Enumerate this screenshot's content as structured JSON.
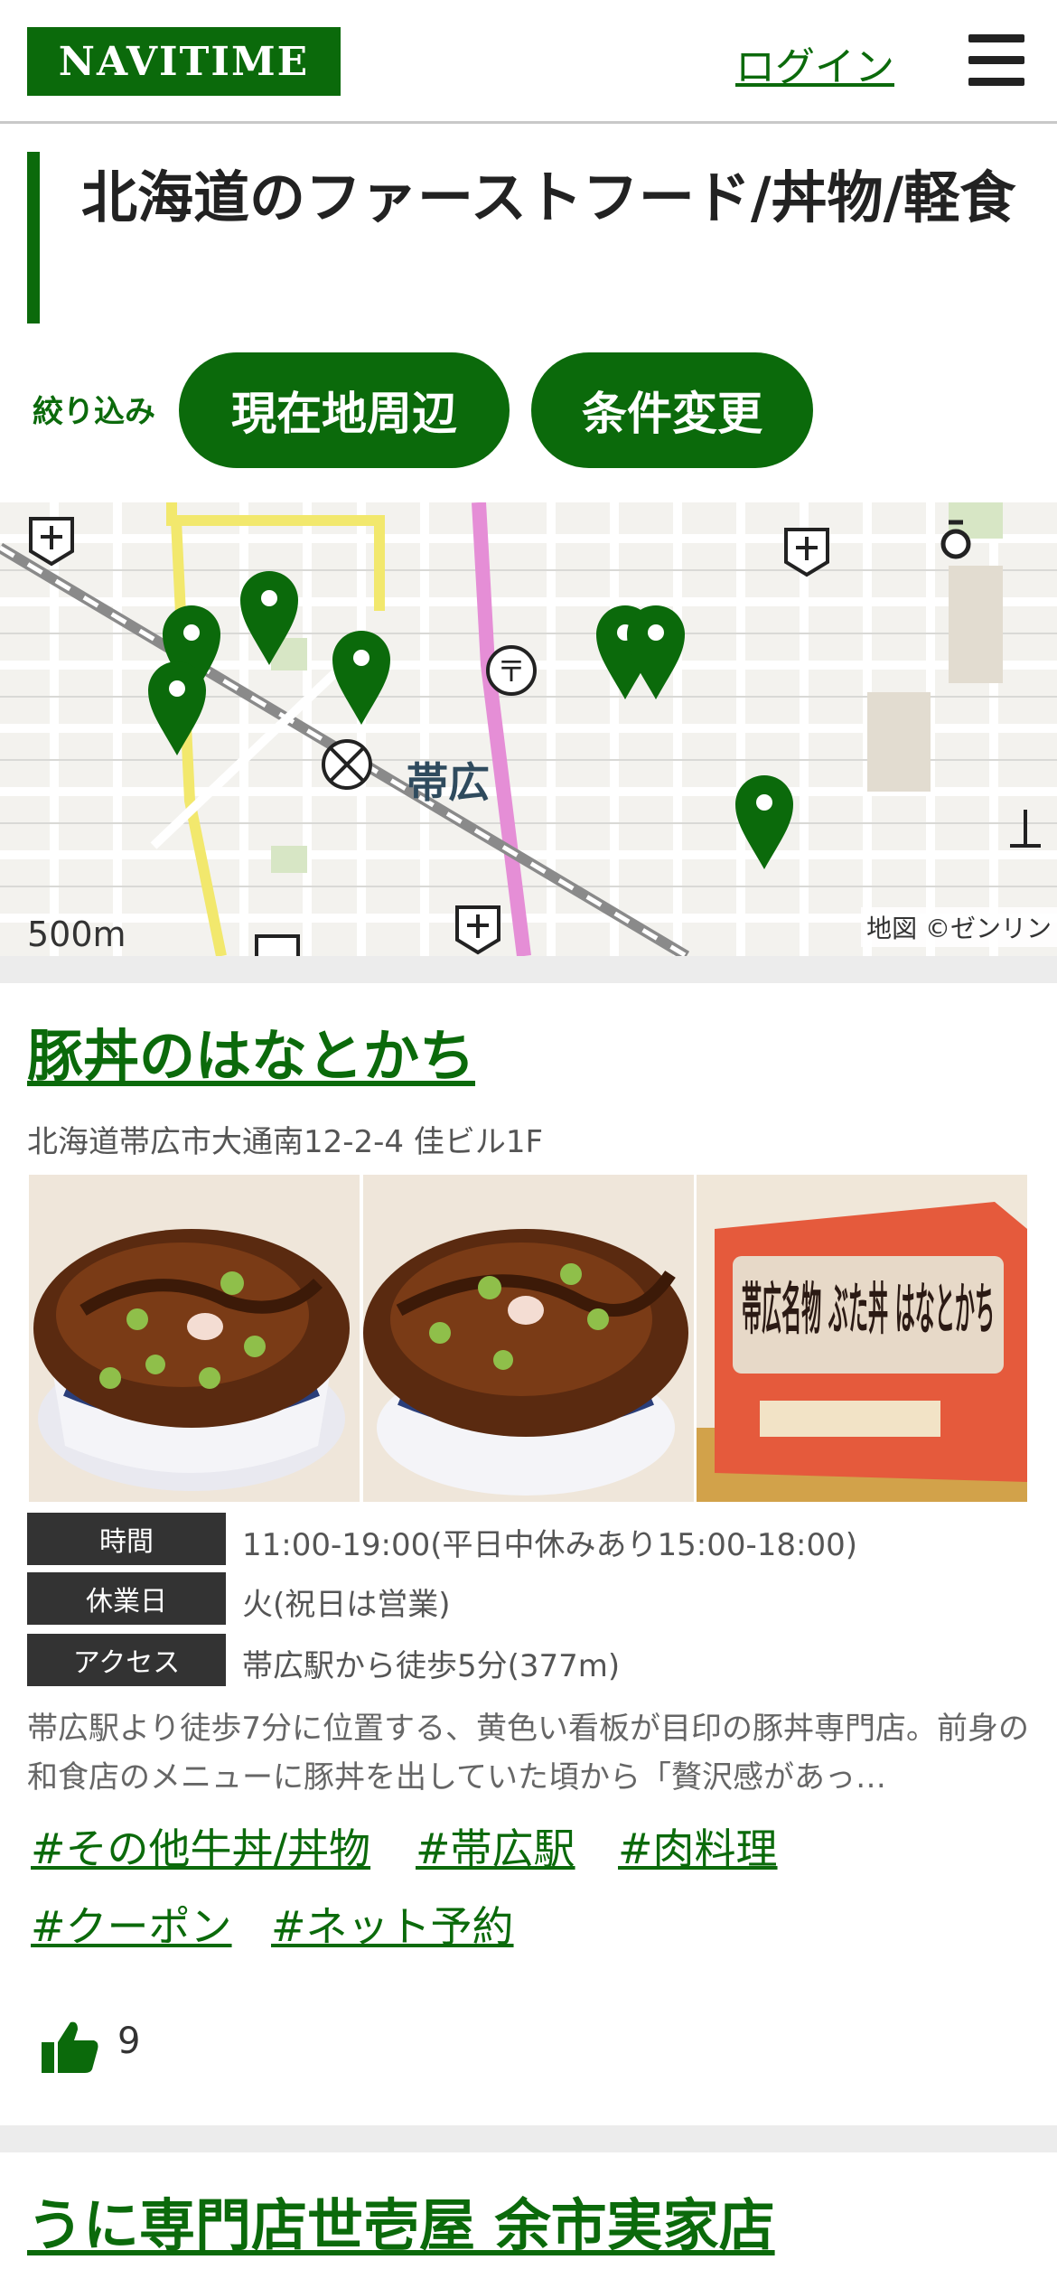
{
  "header": {
    "logo_text": "NAVITIME",
    "login_label": "ログイン",
    "menu_icon": "hamburger-menu-icon"
  },
  "page": {
    "title": "北海道のファーストフード/丼物/軽食"
  },
  "filter": {
    "label": "絞り込み",
    "buttons": [
      "現在地周辺",
      "条件変更"
    ]
  },
  "map": {
    "station_label": "帯広",
    "scale_label": "500m",
    "credit": "地図 ©ゼンリン",
    "pin_count": 7,
    "pin_color": "#0b6a0b"
  },
  "listings": [
    {
      "name": "豚丼のはなとかち",
      "address": "北海道帯広市大通南12-2-4 佳ビル1F",
      "photos": [
        {
          "alt": "butadon bowl photo"
        },
        {
          "alt": "butadon bowl photo"
        },
        {
          "box_text": "帯広名物 ぶた丼 はなとかち"
        }
      ],
      "info": [
        {
          "key": "時間",
          "value": "11:00-19:00(平日中休みあり15:00-18:00)"
        },
        {
          "key": "休業日",
          "value": "火(祝日は営業)"
        },
        {
          "key": "アクセス",
          "value": "帯広駅から徒歩5分(377m)"
        }
      ],
      "description": "帯広駅より徒歩7分に位置する、黄色い看板が目印の豚丼専門店。前身の和食店のメニューに豚丼を出していた頃から「贅沢感があっ…",
      "tags": [
        "#その他牛丼/丼物",
        "#帯広駅",
        "#肉料理",
        "#クーポン",
        "#ネット予約"
      ],
      "likes": "9"
    },
    {
      "name": "うに専門店世壱屋 余市実家店"
    }
  ],
  "colors": {
    "brand_green": "#0b6a0b",
    "label_bg": "#333333",
    "separator": "#ececec"
  }
}
